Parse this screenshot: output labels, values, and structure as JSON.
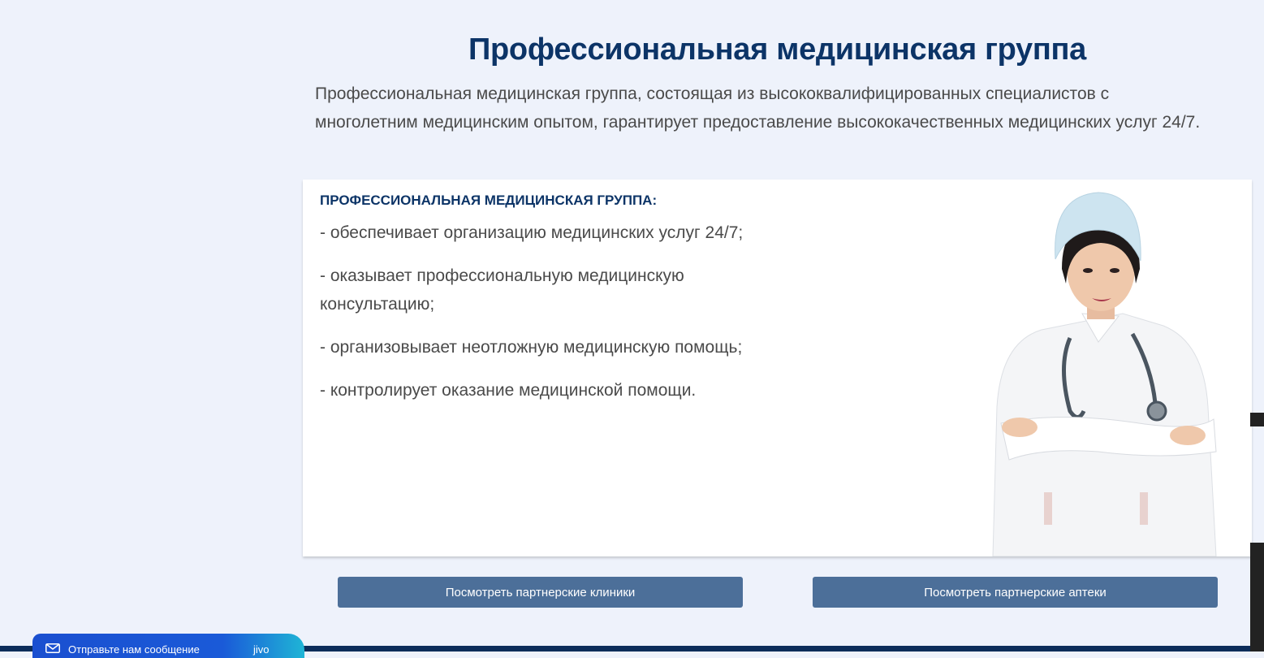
{
  "section": {
    "title": "Профессиональная медицинская группа",
    "intro": "Профессиональная медицинская группа, состоящая из высококвалифицированных специалистов с многолетним медицинским опытом, гарантирует предоставление высококачественных медицинских услуг 24/7."
  },
  "card": {
    "heading": "ПРОФЕССИОНАЛЬНАЯ МЕДИЦИНСКАЯ ГРУППА:",
    "duties": [
      "- обеспечивает организацию медицинских услуг 24/7;",
      "- оказывает профессиональную медицинскую консультацию;",
      "- организовывает неотложную медицинскую помощь;",
      "- контролирует оказание медицинской помощи."
    ],
    "image_icon": "doctor-photo"
  },
  "buttons": {
    "clinics_label": "Посмотреть партнерские клиники",
    "pharmacies_label": "Посмотреть партнерские аптеки"
  },
  "chat_widget": {
    "label": "Отправьте нам сообщение",
    "brand": "jivo",
    "icon": "mail-icon"
  },
  "colors": {
    "title": "#0c3467",
    "button": "#4c6f99",
    "background": "#eef2fb",
    "footer": "#0c2d5a"
  }
}
